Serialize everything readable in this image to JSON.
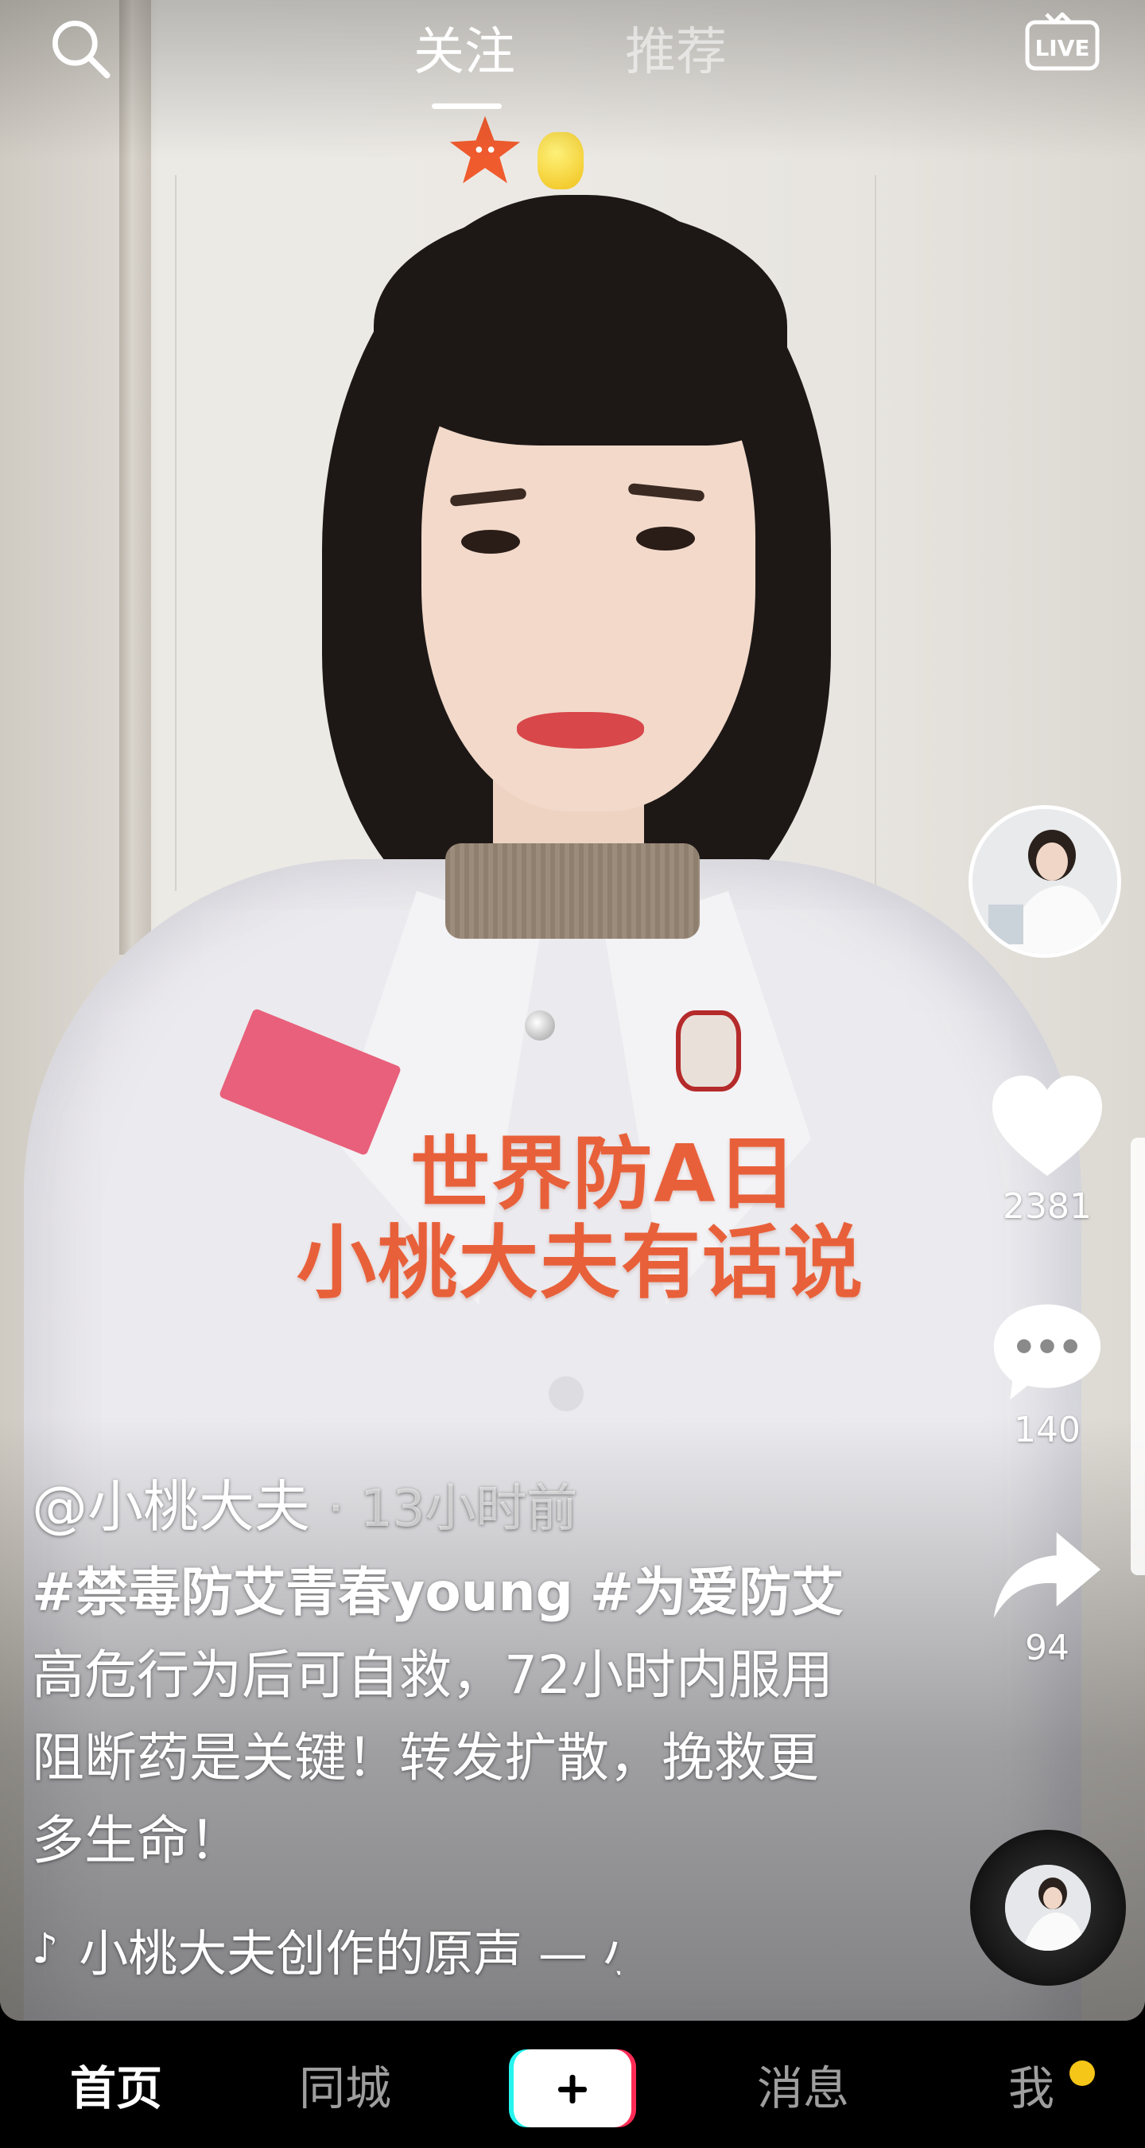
{
  "top_bar": {
    "tabs": [
      {
        "label": "关注",
        "active": true
      },
      {
        "label": "推荐",
        "active": false
      }
    ],
    "icons": {
      "left": "search-icon",
      "right": "live-icon"
    },
    "live_label": "LIVE"
  },
  "video": {
    "overlay_caption": [
      "世界防A日",
      "小桃大夫有话说"
    ],
    "overlay_color": "#e8603a"
  },
  "author": {
    "handle": "@小桃大夫",
    "time": "· 13小时前"
  },
  "caption": {
    "hashtags": [
      "#禁毒防艾青春young",
      "#为爱防艾"
    ],
    "text": "高危行为后可自救，72小时内服用阻断药是关键！转发扩散，挽救更多生命！"
  },
  "music": {
    "icon": "music-note-icon",
    "text": "小桃大夫创作的原声 — 小桃大夫"
  },
  "actions": {
    "likes": "2381",
    "comments": "140",
    "shares": "94"
  },
  "bottom_nav": {
    "items": [
      "首页",
      "同城",
      "消息",
      "我"
    ],
    "active": "首页",
    "notify_color": "#f5c518"
  }
}
